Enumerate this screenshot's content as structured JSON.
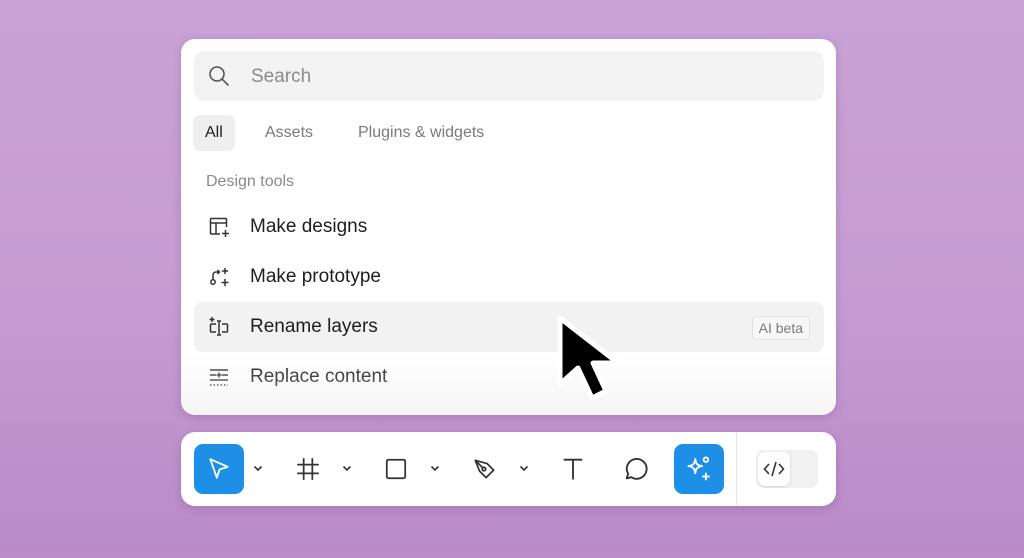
{
  "search": {
    "placeholder": "Search",
    "icon": "search-icon"
  },
  "tabs": [
    {
      "label": "All",
      "active": true
    },
    {
      "label": "Assets",
      "active": false
    },
    {
      "label": "Plugins & widgets",
      "active": false
    }
  ],
  "section": {
    "label": "Design tools"
  },
  "items": [
    {
      "label": "Make designs",
      "icon": "make-designs-icon",
      "badge": ""
    },
    {
      "label": "Make prototype",
      "icon": "make-prototype-icon",
      "badge": ""
    },
    {
      "label": "Rename layers",
      "icon": "rename-layers-icon",
      "badge": "AI beta",
      "hovered": true
    },
    {
      "label": "Replace content",
      "icon": "replace-content-icon",
      "badge": ""
    }
  ],
  "toolbar": {
    "tools": [
      {
        "name": "move",
        "icon": "move-cursor-icon",
        "active": true,
        "has_dropdown": true
      },
      {
        "name": "frame",
        "icon": "frame-icon",
        "active": false,
        "has_dropdown": true
      },
      {
        "name": "rectangle",
        "icon": "rectangle-icon",
        "active": false,
        "has_dropdown": true
      },
      {
        "name": "pen",
        "icon": "pen-icon",
        "active": false,
        "has_dropdown": true
      },
      {
        "name": "text",
        "icon": "text-icon",
        "active": false,
        "has_dropdown": false
      },
      {
        "name": "comment",
        "icon": "comment-icon",
        "active": false,
        "has_dropdown": false
      },
      {
        "name": "actions",
        "icon": "ai-sparkle-icon",
        "active": true,
        "has_dropdown": false
      }
    ],
    "dev_mode_icon": "code-icon"
  },
  "colors": {
    "background": "#c9a2d6",
    "accent": "#1e8fe6",
    "panel": "#ffffff",
    "text": "#1e1e1e",
    "muted": "#8a8a8a"
  }
}
